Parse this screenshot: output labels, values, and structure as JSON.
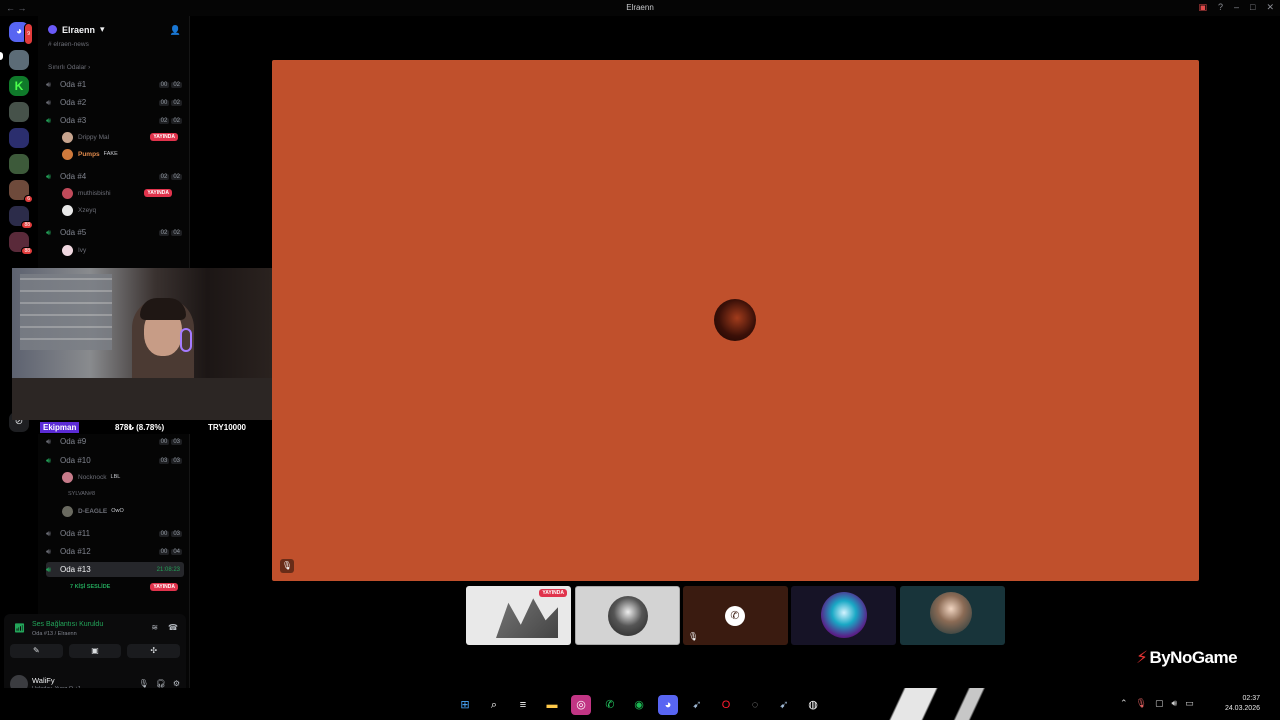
{
  "window": {
    "title": "Elraenn",
    "nav": "←  →"
  },
  "server": {
    "name": "Elraenn",
    "news_channel": "elraen-news",
    "category": "Sınırlı Odalar"
  },
  "rail": {
    "badges": [
      "9",
      "6",
      "88",
      "88"
    ]
  },
  "channels": [
    {
      "name": "Oda #1",
      "counts": [
        "00",
        "02"
      ],
      "active": false
    },
    {
      "name": "Oda #2",
      "counts": [
        "00",
        "02"
      ],
      "active": false
    },
    {
      "name": "Oda #3",
      "counts": [
        "02",
        "02"
      ],
      "active": true
    },
    {
      "name": "Oda #4",
      "counts": [
        "02",
        "02"
      ],
      "active": true
    },
    {
      "name": "Oda #5",
      "counts": [
        "02",
        "02"
      ],
      "active": true
    },
    {
      "name": "Oda #9",
      "counts": [
        "00",
        "03"
      ],
      "active": false
    },
    {
      "name": "Oda #10",
      "counts": [
        "03",
        "03"
      ],
      "active": true
    },
    {
      "name": "Oda #11",
      "counts": [
        "00",
        "03"
      ],
      "active": false
    },
    {
      "name": "Oda #12",
      "counts": [
        "00",
        "04"
      ],
      "active": false
    },
    {
      "name": "Oda #13",
      "counts": [],
      "active": true,
      "timer": "21:08:23"
    }
  ],
  "users": {
    "oda3": [
      {
        "name": "Drippy Mal",
        "live": "YAYINDA",
        "tag": ""
      },
      {
        "name": "Pumps",
        "live": "",
        "tag": "FAKE"
      }
    ],
    "oda4": [
      {
        "name": "muthisbishi",
        "live": "YAYINDA",
        "tag": ""
      },
      {
        "name": "Xzeyq",
        "live": "",
        "tag": ""
      }
    ],
    "oda5": [
      {
        "name": "Ivy",
        "live": "",
        "tag": ""
      }
    ],
    "oda10": [
      {
        "name": "Nocknock",
        "live": "",
        "tag": "LBL"
      },
      {
        "name": "SYLVAN#8",
        "live": "",
        "tag": ""
      },
      {
        "name": "D-EAGLE",
        "live": "",
        "tag": "OwO"
      }
    ],
    "oda13_label": "7 KİŞİ SESLİDE",
    "oda13_live": "YAYINDA"
  },
  "ticker": {
    "brand": "Ekipman",
    "price": "878₺ (8.78%)",
    "currency": "TRY10000"
  },
  "voice": {
    "status": "Ses Bağlantısı Kuruldu",
    "location": "Oda #13 / Elraenn"
  },
  "me": {
    "name": "WaliFy",
    "status": "Heloday, Yung O +1"
  },
  "stage": {
    "color": "#c0502c"
  },
  "thumbnails": {
    "first_live": "YAYINDA"
  },
  "watermark": "ByNoGame",
  "clock": {
    "time": "02:37",
    "date": "24.03.2026"
  },
  "icons": {
    "speaker": "speaker-icon",
    "mute": "mic-off-icon",
    "call": "phone-icon",
    "settings": "gear-icon"
  }
}
